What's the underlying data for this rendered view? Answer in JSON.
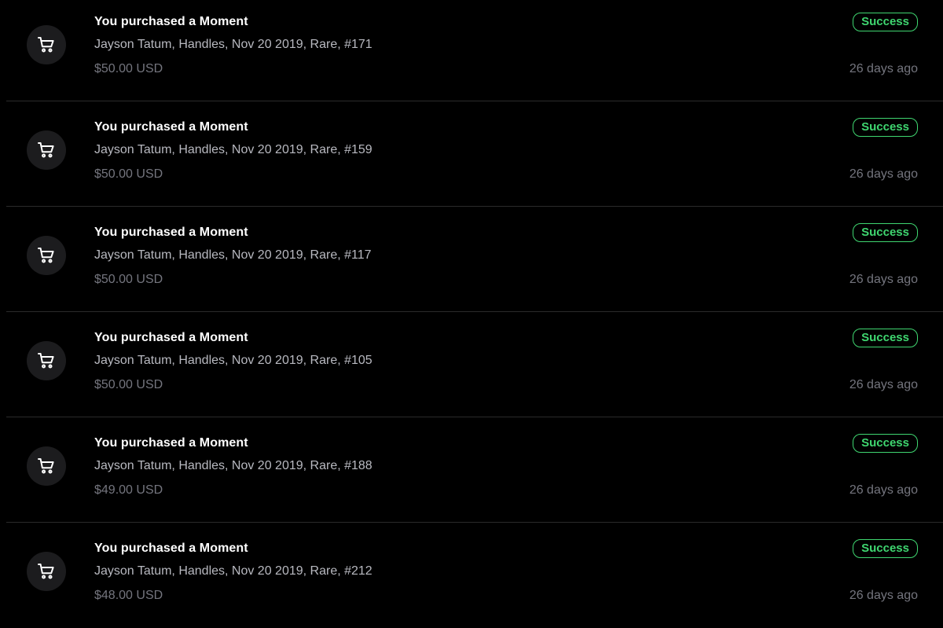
{
  "colors": {
    "background": "#000000",
    "divider": "#2b2b2b",
    "icon_circle": "#1c1c1e",
    "title": "#ffffff",
    "subtitle": "#b8b9c0",
    "muted": "#74757e",
    "success": "#3fd670"
  },
  "transactions": [
    {
      "icon": "shopping-cart-icon",
      "title": "You purchased a Moment",
      "description": "Jayson Tatum, Handles, Nov 20 2019, Rare, #171",
      "price": "$50.00 USD",
      "status": "Success",
      "time": "26 days ago"
    },
    {
      "icon": "shopping-cart-icon",
      "title": "You purchased a Moment",
      "description": "Jayson Tatum, Handles, Nov 20 2019, Rare, #159",
      "price": "$50.00 USD",
      "status": "Success",
      "time": "26 days ago"
    },
    {
      "icon": "shopping-cart-icon",
      "title": "You purchased a Moment",
      "description": "Jayson Tatum, Handles, Nov 20 2019, Rare, #117",
      "price": "$50.00 USD",
      "status": "Success",
      "time": "26 days ago"
    },
    {
      "icon": "shopping-cart-icon",
      "title": "You purchased a Moment",
      "description": "Jayson Tatum, Handles, Nov 20 2019, Rare, #105",
      "price": "$50.00 USD",
      "status": "Success",
      "time": "26 days ago"
    },
    {
      "icon": "shopping-cart-icon",
      "title": "You purchased a Moment",
      "description": "Jayson Tatum, Handles, Nov 20 2019, Rare, #188",
      "price": "$49.00 USD",
      "status": "Success",
      "time": "26 days ago"
    },
    {
      "icon": "shopping-cart-icon",
      "title": "You purchased a Moment",
      "description": "Jayson Tatum, Handles, Nov 20 2019, Rare, #212",
      "price": "$48.00 USD",
      "status": "Success",
      "time": "26 days ago"
    }
  ]
}
